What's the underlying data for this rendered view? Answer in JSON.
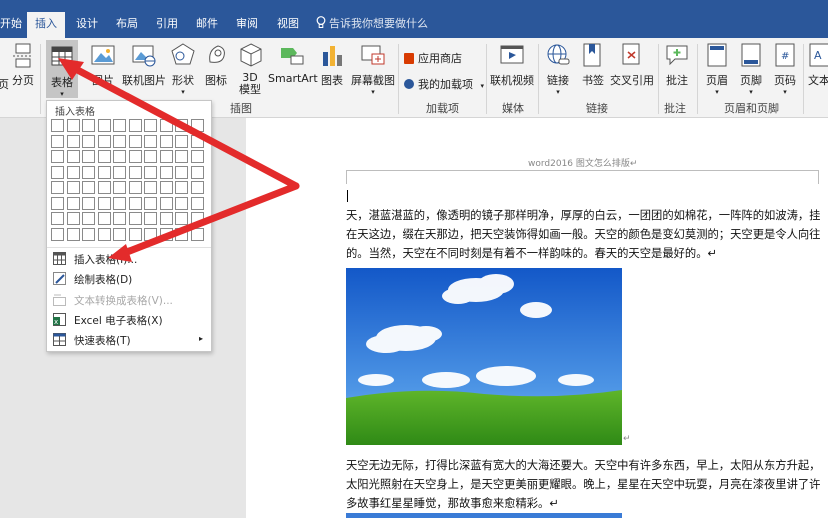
{
  "tabs": [
    {
      "label": "开始"
    },
    {
      "label": "插入"
    },
    {
      "label": "设计"
    },
    {
      "label": "布局"
    },
    {
      "label": "引用"
    },
    {
      "label": "邮件"
    },
    {
      "label": "审阅"
    },
    {
      "label": "视图"
    }
  ],
  "tell_me": "告诉我你想要做什么",
  "ribbon": {
    "page_break": "分页",
    "page_break_left": "页",
    "table": "表格",
    "picture": "图片",
    "online_picture": "联机图片",
    "shapes": "形状",
    "icons": "图标",
    "model_3d_line1": "3D",
    "model_3d_line2": "模型",
    "smartart": "SmartArt",
    "chart": "图表",
    "screenshot": "屏幕截图",
    "illustrations_group": "插图",
    "app_store": "应用商店",
    "my_addins": "我的加载项",
    "addins_group": "加载项",
    "online_video": "联机视频",
    "media_group": "媒体",
    "link": "链接",
    "bookmark": "书签",
    "cross_ref": "交叉引用",
    "links_group": "链接",
    "comment": "批注",
    "comments_group": "批注",
    "header": "页眉",
    "footer": "页脚",
    "page_number": "页码",
    "header_footer_group": "页眉和页脚",
    "textbox": "文本"
  },
  "menu": {
    "title": "插入表格",
    "items": [
      {
        "label": "插入表格(I)...",
        "icon": "table-icon"
      },
      {
        "label": "绘制表格(D)",
        "icon": "pencil-icon"
      },
      {
        "label": "文本转换成表格(V)...",
        "icon": "convert-icon"
      },
      {
        "label": "Excel 电子表格(X)",
        "icon": "excel-icon"
      },
      {
        "label": "快速表格(T)",
        "icon": "quick-table-icon"
      }
    ]
  },
  "document": {
    "header_text": "word2016 图文怎么排版↵",
    "para1": "天，湛蓝湛蓝的，像透明的镜子那样明净，厚厚的白云，一团团的如棉花，一阵阵的如波涛，挂在天这边，缀在天那边，把天空装饰得如画一般。天空的颜色是变幻莫测的；天空更是令人向往的。当然，天空在不同时刻是有着不一样韵味的。春天的天空是最好的。↵",
    "para2": "天空无边无际，打得比深蓝有宽大的大海还要大。天空中有许多东西，早上，太阳从东方升起，太阳光照射在天空身上，是天空更美丽更耀眼。晚上，星星在天空中玩耍，月亮在漆夜里讲了许多故事红星星睡觉，那故事愈来愈精彩。↵"
  },
  "colors": {
    "accent": "#2b579a",
    "arrow": "#e32b2b"
  }
}
